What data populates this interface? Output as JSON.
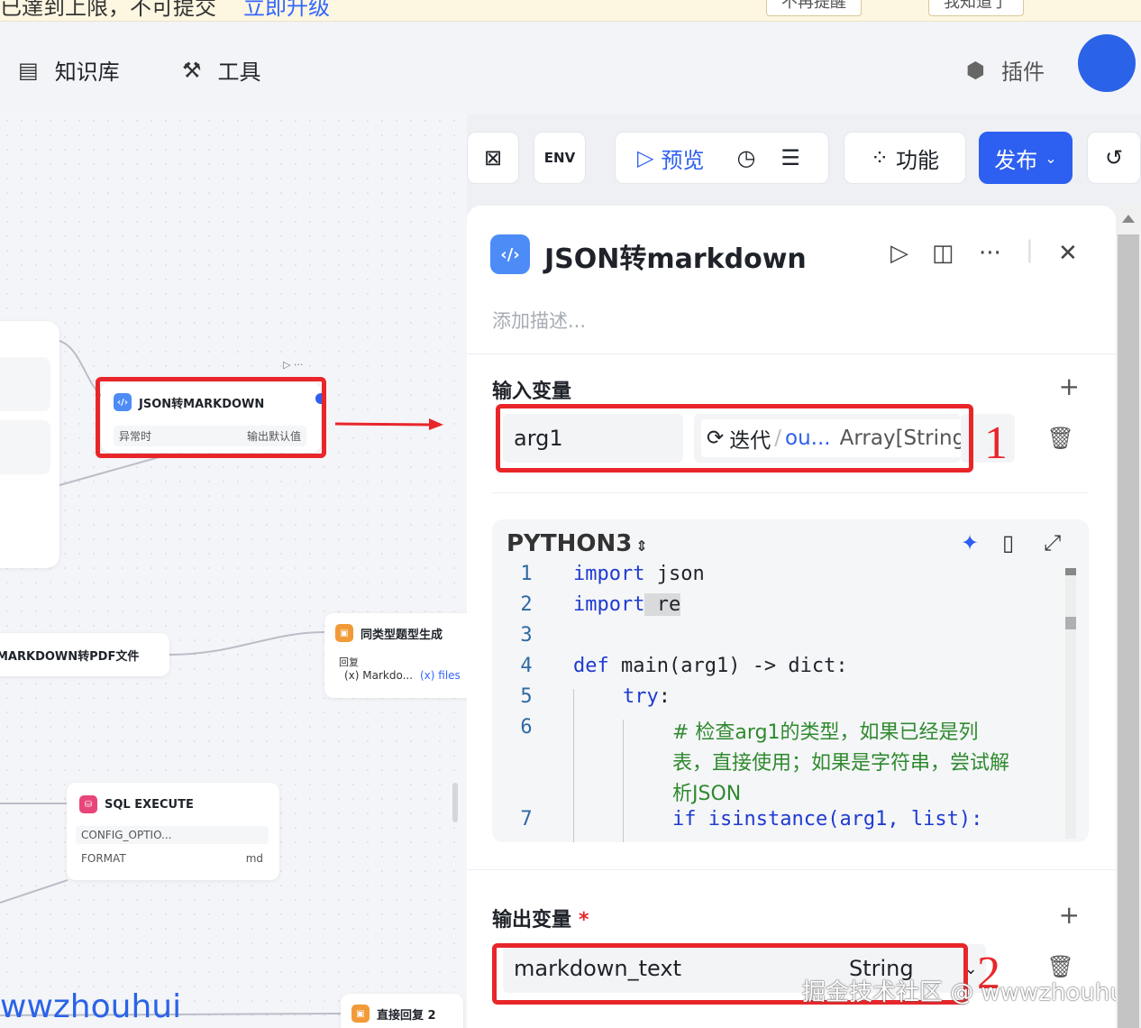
{
  "notification": {
    "text": "已達到上限，不可提交",
    "link": "立即升级",
    "btn1": "不再提醒",
    "btn2": "我知道了"
  },
  "nav": {
    "knowledge": "知识库",
    "tools": "工具",
    "plugins": "插件"
  },
  "toolbar": {
    "env": "ENV",
    "preview": "预览",
    "features": "功能",
    "publish": "发布"
  },
  "canvas": {
    "json_node": {
      "title": "JSON转MARKDOWN",
      "row_left": "异常时",
      "row_right": "输出默认值"
    },
    "pdf_node": {
      "title": "MARKDOWN转PDF文件"
    },
    "gen_node": {
      "title": "同类型题型生成",
      "sub": "回复",
      "tag1": "(x) Markdo...",
      "tag2": "(x) files"
    },
    "sql_node": {
      "title": "SQL EXECUTE",
      "row1": "CONFIG_OPTIO...",
      "row2_left": "FORMAT",
      "row2_right": "md"
    },
    "reply_node": {
      "title": "直接回复 2"
    }
  },
  "panel": {
    "title": "JSON转markdown",
    "description_placeholder": "添加描述...",
    "input_section": "输入变量",
    "input_var": {
      "name": "arg1",
      "source": "迭代",
      "ref": "ou...",
      "type": "Array[String]"
    },
    "code": {
      "language": "PYTHON3",
      "lines": [
        {
          "n": "1",
          "kw": "import",
          "rest": " json"
        },
        {
          "n": "2",
          "kw": "import",
          "rest": " re"
        },
        {
          "n": "3",
          "kw": "",
          "rest": ""
        },
        {
          "n": "4",
          "kw": "def",
          "rest": " main(arg1) -> dict:"
        },
        {
          "n": "5",
          "kw": "try",
          "rest": ":"
        },
        {
          "n": "6",
          "kw": "",
          "rest": "# 检查arg1的类型，如果已经是列"
        },
        {
          "n": "",
          "kw": "",
          "rest": "表，直接使用；如果是字符串，尝试解"
        },
        {
          "n": "",
          "kw": "",
          "rest": "析JSON"
        },
        {
          "n": "7",
          "kw": "if",
          "rest": " isinstance(arg1, list):"
        }
      ]
    },
    "output_section": "输出变量",
    "output_var": {
      "name": "markdown_text",
      "type": "String"
    }
  },
  "annotations": {
    "label1": "1",
    "label2": "2",
    "watermark": "掘金技术社区 @ wwwzhouhui",
    "watermark_left": "wwzhouhui"
  }
}
